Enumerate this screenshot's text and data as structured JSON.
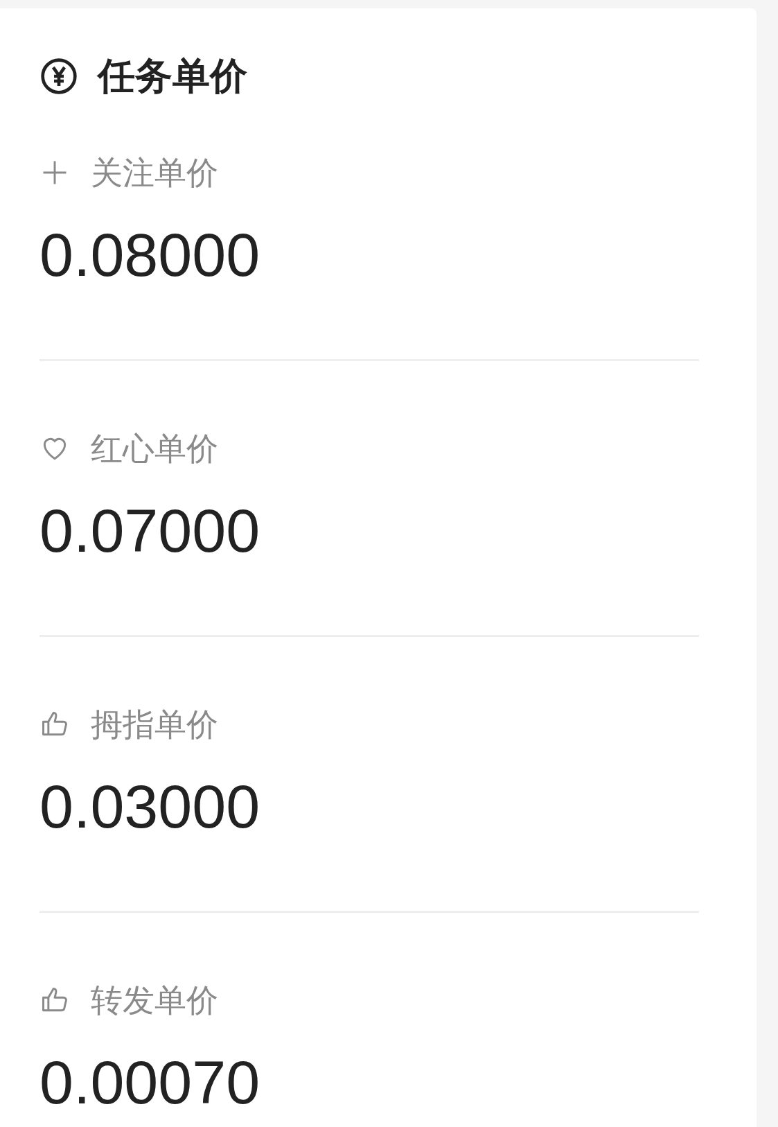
{
  "title": "任务单价",
  "items": [
    {
      "kind": "plus",
      "label": "关注单价",
      "value": "0.08000"
    },
    {
      "kind": "heart",
      "label": "红心单价",
      "value": "0.07000"
    },
    {
      "kind": "thumb",
      "label": "拇指单价",
      "value": "0.03000"
    },
    {
      "kind": "thumb",
      "label": "转发单价",
      "value": "0.00070"
    }
  ]
}
